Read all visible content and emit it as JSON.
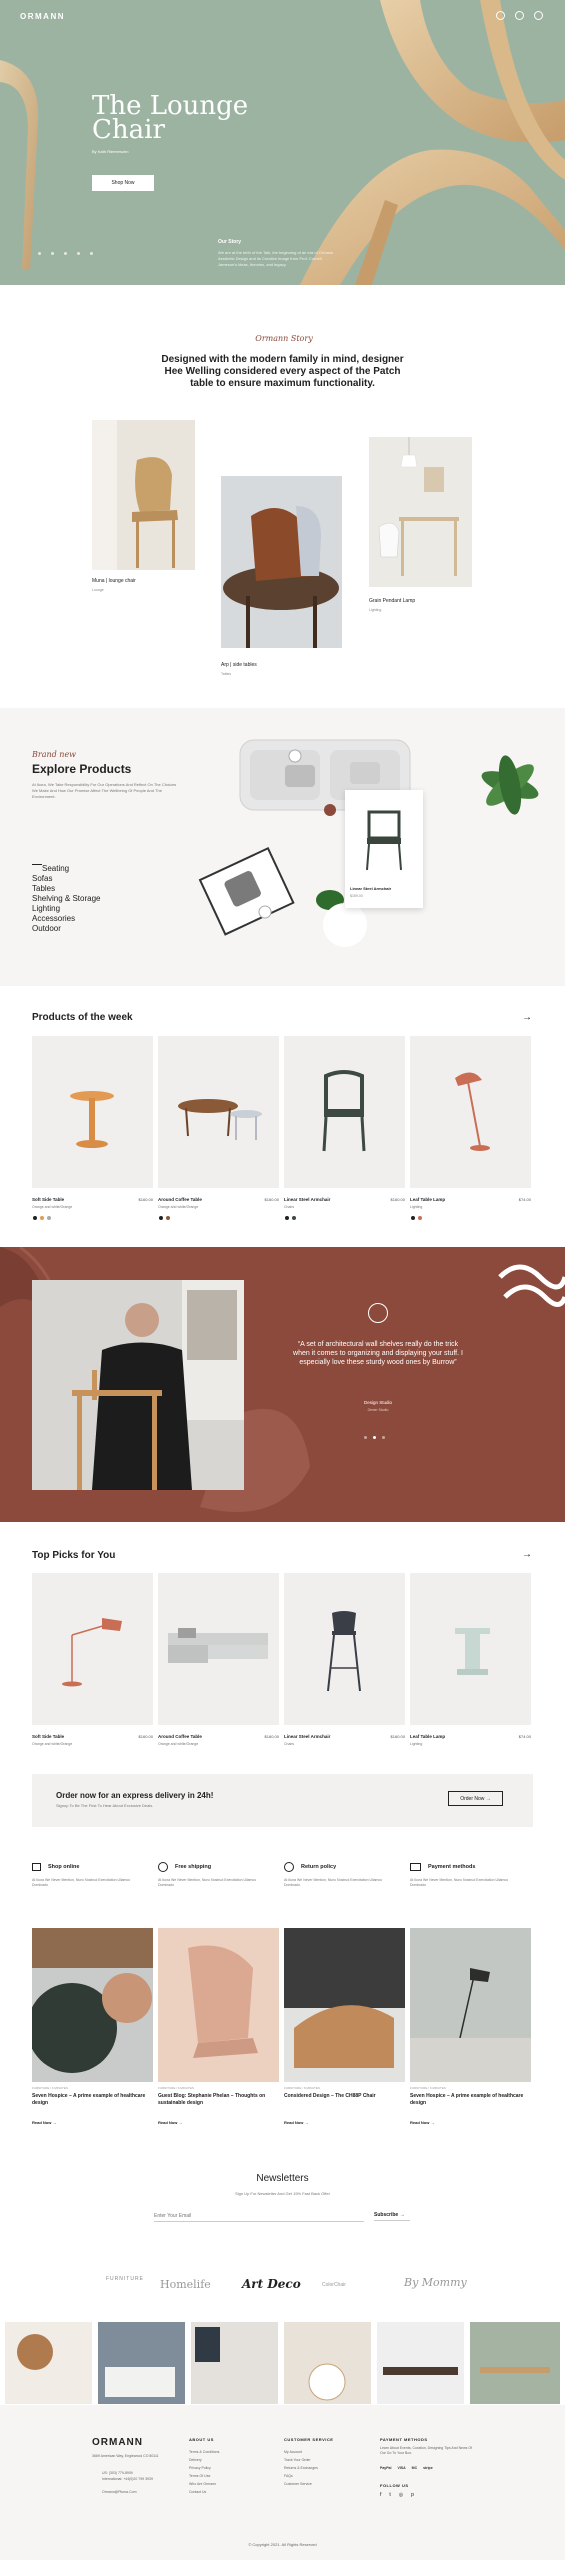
{
  "header": {
    "logo": "ORMANN"
  },
  "hero": {
    "title_line1": "The Lounge",
    "title_line2": "Chair",
    "by": "By Kath Riemerschn",
    "button": "Shop Now",
    "story_title": "Our Story",
    "story_text": "We are at the birth of the Talk, the beginning of an era of Ormann Aesthetic Design and its Creative Image from Prof. Cornell Jameson's ideas, theories, and legacy.",
    "colors": {
      "bg": "#9db3a2",
      "accent": "#8b4a3c"
    }
  },
  "intro": {
    "script": "Ormann Story",
    "heading": "Designed with the modern family in mind, designer Hee Welling considered every aspect of the Patch table to ensure maximum functionality.",
    "items": [
      {
        "name": "Muna | lounge chair",
        "sub": "Lounge"
      },
      {
        "name": "Arp | side tables",
        "sub": "Tables"
      },
      {
        "name": "Grain Pendant Lamp",
        "sub": "Lighting"
      }
    ]
  },
  "explore": {
    "script": "Brand new",
    "title": "Explore Products",
    "desc": "At Ikora, We Take Responsibility For Our Operations And Reflect On The Choices We Make And How Our Promise Affect The Wellbeing Of People And The Environment.",
    "categories": [
      "Seating",
      "Sofas",
      "Tables",
      "Shelving & Storage",
      "Lighting",
      "Accessories",
      "Outdoor"
    ],
    "tooltip_name": "Linear Steel Armchair",
    "tooltip_price": "$159.00"
  },
  "products_week": {
    "title": "Products of the week",
    "items": [
      {
        "name": "Soft Side Table",
        "sub": "Orange and white/Orange",
        "price": "$160.00"
      },
      {
        "name": "Around Coffee Table",
        "sub": "Orange and white/Orange",
        "price": "$160.00"
      },
      {
        "name": "Linear Steel Armchair",
        "sub": "Chairs",
        "price": "$160.00"
      },
      {
        "name": "Leaf Table Lamp",
        "sub": "Lighting",
        "price": "$74.00"
      }
    ]
  },
  "testimonial": {
    "quote": "“A set of architectural wall shelves really do the trick when it comes to organizing and displaying your stuff. I especially love these sturdy wood ones by Burrow”",
    "author": "Design Studio",
    "role": "Ormer Studio"
  },
  "top_picks": {
    "title": "Top Picks for You",
    "items": [
      {
        "name": "Soft Side Table",
        "sub": "Orange and white/Orange",
        "price": "$160.00"
      },
      {
        "name": "Around Coffee Table",
        "sub": "Orange and white/Orange",
        "price": "$160.00"
      },
      {
        "name": "Linear Steel Armchair",
        "sub": "Chairs",
        "price": "$160.00"
      },
      {
        "name": "Leaf Table Lamp",
        "sub": "Lighting",
        "price": "$74.00"
      }
    ]
  },
  "delivery": {
    "title": "Order now for an express delivery in 24h!",
    "sub": "Signup To Be The First To Hear About Exclusive Deals.",
    "button": "Order Now"
  },
  "features": [
    {
      "title": "Shop online",
      "desc": "At Ikora We Never Mention, Nunc Nostrud Exercitation Ullamco Dominado"
    },
    {
      "title": "Free shipping",
      "desc": "At Ikora We Never Mention, Nunc Nostrud Exercitation Ullamco Dominado"
    },
    {
      "title": "Return policy",
      "desc": "At Ikora We Never Mention, Nunc Nostrud Exercitation Ullamco Dominado"
    },
    {
      "title": "Payment methods",
      "desc": "At Ikora We Never Mention, Nunc Nostrud Exercitation Ullamco Dominado"
    }
  ],
  "blog": [
    {
      "meta": "FURNITURE / 6 MINUTES",
      "title": "Seven Hospice – A prime example of healthcare design",
      "more": "Read Now"
    },
    {
      "meta": "FURNITURE / 6 MINUTES",
      "title": "Guest Blog: Stephanie Phelan – Thoughts on sustainable design",
      "more": "Read Now"
    },
    {
      "meta": "FURNITURE / 6 MINUTES",
      "title": "Considered Design – The CH88P Chair",
      "more": "Read Now"
    },
    {
      "meta": "FURNITURE / 6 MINUTES",
      "title": "Seven Hospice – A prime example of healthcare design",
      "more": "Read Now"
    }
  ],
  "newsletter": {
    "title": "Newsletters",
    "sub": "Sign Up For Newsletter And Get 15% Fast Back Offer",
    "placeholder": "Enter Your Email",
    "button": "Subscribe"
  },
  "brands": [
    "FURNITURE",
    "Homelife",
    "Art Deco",
    "ColorChair",
    "By Mommy"
  ],
  "footer": {
    "logo": "ORMANN",
    "address": "3669 American Way, Englewood CO 80111",
    "phone": "US: (303) 779-8909",
    "phone2": "International: +44(0)20 799 3939",
    "email": "Ormann@Pluma.Com",
    "col1_title": "ABOUT US",
    "col1": [
      "Terms & Conditions",
      "Delivery",
      "Privacy Policy",
      "Terms Of Use",
      "Who Are Ormann",
      "Contact Us"
    ],
    "col2_title": "CUSTOMER SERVICE",
    "col2": [
      "My Account",
      "Track Your Order",
      "Returns & Exchanges",
      "FAQs",
      "Customer Service"
    ],
    "col3_title": "PAYMENT METHODS",
    "col3_desc": "Learn About Events, Curation, Designing Tips And News Of Our Go To Your Box.",
    "payments": [
      "PayPal",
      "VISA",
      "MC",
      "stripe"
    ],
    "follow": "FOLLOW US",
    "copyright": "© Copyright 2021. All Rights Reserved"
  }
}
